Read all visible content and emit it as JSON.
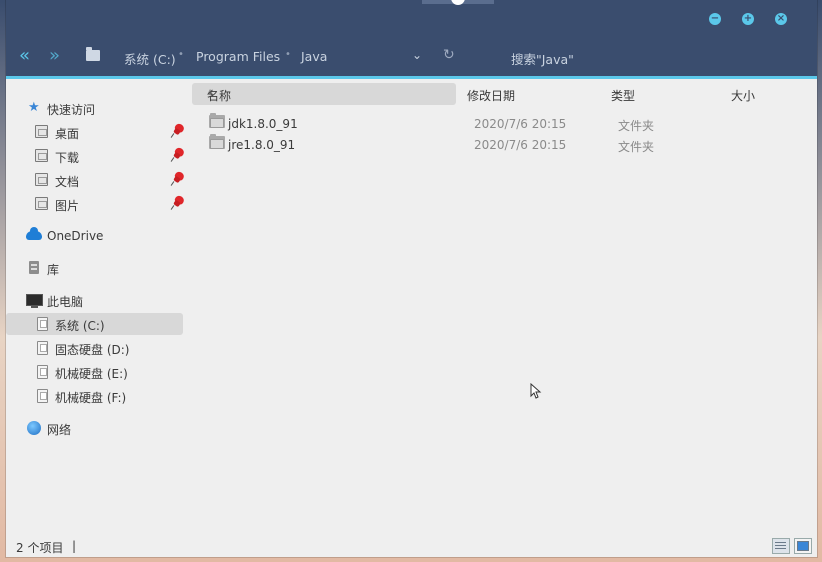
{
  "window_controls": {
    "minimize_glyph": "−",
    "maximize_glyph": "+",
    "close_glyph": "×"
  },
  "toolbar": {
    "back_glyph": "«",
    "forward_glyph": "»",
    "breadcrumb": [
      "系统 (C:)",
      "Program Files",
      "Java"
    ],
    "separator": "•",
    "dropdown_glyph": "⌄",
    "refresh_glyph": "↻",
    "search_placeholder": "搜索\"Java\""
  },
  "sidebar": {
    "quick_access": "快速访问",
    "pinned": [
      {
        "label": "桌面"
      },
      {
        "label": "下载"
      },
      {
        "label": "文档"
      },
      {
        "label": "图片"
      }
    ],
    "onedrive": "OneDrive",
    "library": "库",
    "this_pc": "此电脑",
    "drives": [
      {
        "label": "系统 (C:)",
        "selected": true
      },
      {
        "label": "固态硬盘 (D:)",
        "selected": false
      },
      {
        "label": "机械硬盘 (E:)",
        "selected": false
      },
      {
        "label": "机械硬盘 (F:)",
        "selected": false
      }
    ],
    "network": "网络"
  },
  "columns": {
    "name": "名称",
    "modified": "修改日期",
    "type": "类型",
    "size": "大小",
    "sort_glyph": "▲"
  },
  "files": [
    {
      "name": "jdk1.8.0_91",
      "modified": "2020/7/6 20:15",
      "type": "文件夹",
      "size": ""
    },
    {
      "name": "jre1.8.0_91",
      "modified": "2020/7/6 20:15",
      "type": "文件夹",
      "size": ""
    }
  ],
  "status": {
    "item_count": "2 个项目",
    "divider": "|"
  },
  "colors": {
    "titlebar": "#3a4d6e",
    "accent": "#5bc8ea",
    "window_bg": "#efefef",
    "selection": "#d8d8d8"
  }
}
